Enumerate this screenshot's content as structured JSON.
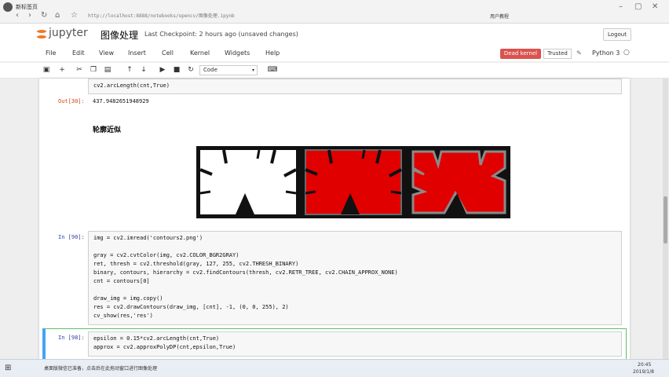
{
  "browser": {
    "tab_title": "新标签页",
    "url": "http://localhost:8888/notebooks/opencv/图像处理.ipynb",
    "user_label": "用户教程",
    "icons": [
      "back-icon",
      "forward-icon",
      "refresh-icon",
      "home-icon",
      "star-icon",
      "menu-icon"
    ]
  },
  "jupyter": {
    "logo_text": "jupyter",
    "notebook_title": "图像处理",
    "checkpoint": "Last Checkpoint: 2 hours ago (unsaved changes)",
    "logout_label": "Logout"
  },
  "menu": {
    "items": [
      "File",
      "Edit",
      "View",
      "Insert",
      "Cell",
      "Kernel",
      "Widgets",
      "Help"
    ],
    "dead_kernel": "Dead kernel",
    "trusted": "Trusted",
    "kernel_name": "Python 3"
  },
  "toolbar": {
    "cell_type": "Code"
  },
  "cells": {
    "top_code": "cv2.arcLength(cnt,True)",
    "out30_prompt": "Out[30]:",
    "out30_value": "437.9482651948929",
    "heading": "轮廓近似",
    "in90_prompt": "In [90]:",
    "in90_lines": [
      "img = cv2.imread('contours2.png')",
      "",
      "gray = cv2.cvtColor(img, cv2.COLOR_BGR2GRAY)",
      "ret, thresh = cv2.threshold(gray, 127, 255, cv2.THRESH_BINARY)",
      "binary, contours, hierarchy = cv2.findContours(thresh, cv2.RETR_TREE, cv2.CHAIN_APPROX_NONE)",
      "cnt = contours[0]",
      "",
      "draw_img = img.copy()",
      "res = cv2.drawContours(draw_img, [cnt], -1, (0, 0, 255), 2)",
      "cv_show(res,'res')"
    ],
    "in98_prompt": "In [98]:",
    "in98_lines": [
      "epsilon = 0.15*cv2.arcLength(cnt,True)",
      "approx = cv2.approxPolyDP(cnt,epsilon,True)"
    ]
  },
  "taskbar": {
    "status": "桌面版微信已准备，点击后在此拖动窗口进行图像处理",
    "time": "20:45",
    "date": "2019/1/8"
  },
  "colors": {
    "accent_red": "#d9534f",
    "jupyter_orange": "#f37726",
    "contour_red": "#e00000"
  }
}
